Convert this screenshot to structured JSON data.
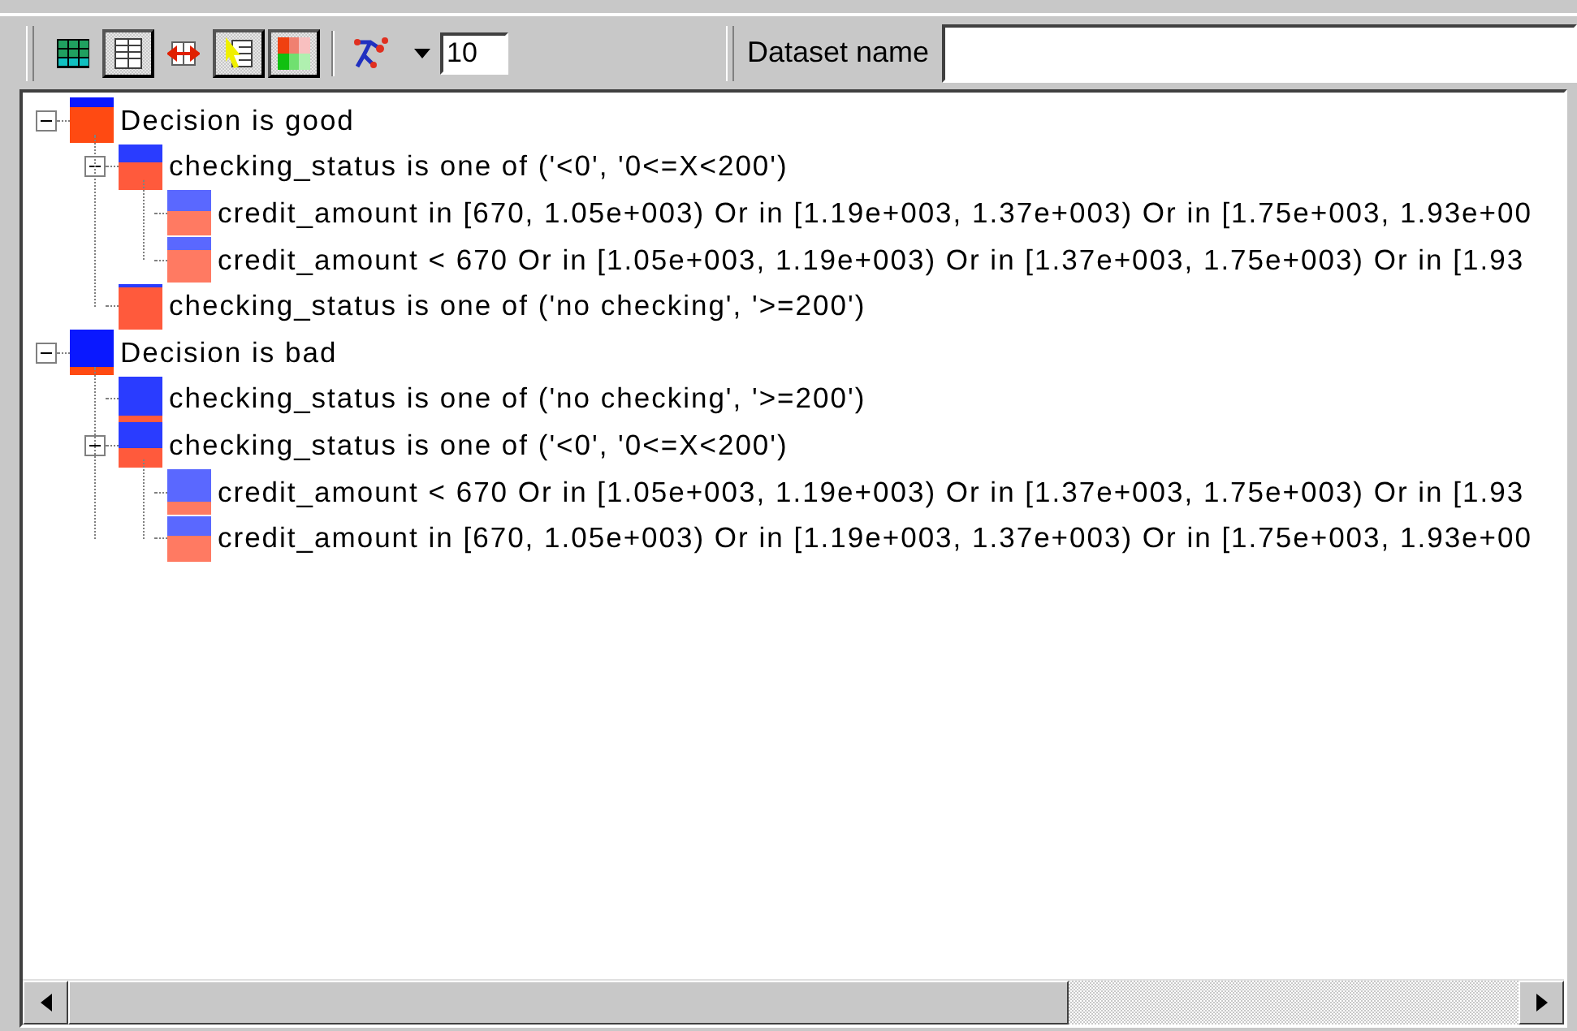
{
  "toolbar": {
    "buttons": [
      {
        "kind": "grid",
        "selected": false
      },
      {
        "kind": "table",
        "selected": true
      },
      {
        "kind": "columns",
        "selected": false
      },
      {
        "kind": "pointer",
        "selected": true
      },
      {
        "kind": "colors",
        "selected": true
      },
      {
        "kind": "tree",
        "selected": false
      }
    ],
    "depth_value": "10",
    "dataset_label": "Dataset name"
  },
  "tree": [
    {
      "label": "Decision is good",
      "level": 0.2,
      "expanded": true,
      "children": [
        {
          "label": "checking_status is one of ('<0', '0<=X<200')",
          "level": 0.4,
          "expanded": true,
          "children": [
            {
              "label": "credit_amount in [670, 1.05e+003) Or in [1.19e+003, 1.37e+003) Or in [1.75e+003, 1.93e+00",
              "level": 0.45
            },
            {
              "label": "credit_amount  < 670 Or in [1.05e+003, 1.19e+003) Or in [1.37e+003, 1.75e+003) Or in [1.93",
              "level": 0.3
            }
          ]
        },
        {
          "label": "checking_status is one of ('no checking', '>=200')",
          "level": 0.1
        }
      ]
    },
    {
      "label": "Decision is bad",
      "level": 0.8,
      "expanded": true,
      "children": [
        {
          "label": "checking_status is one of ('no checking', '>=200')",
          "level": 0.85
        },
        {
          "label": "checking_status is one of ('<0', '0<=X<200')",
          "level": 0.55,
          "expanded": true,
          "children": [
            {
              "label": "credit_amount  < 670 Or in [1.05e+003, 1.19e+003) Or in [1.37e+003, 1.75e+003) Or in [1.93",
              "level": 0.7
            },
            {
              "label": "credit_amount in [670, 1.05e+003) Or in [1.19e+003, 1.37e+003) Or in [1.75e+003, 1.93e+00",
              "level": 0.45
            }
          ]
        }
      ]
    }
  ]
}
